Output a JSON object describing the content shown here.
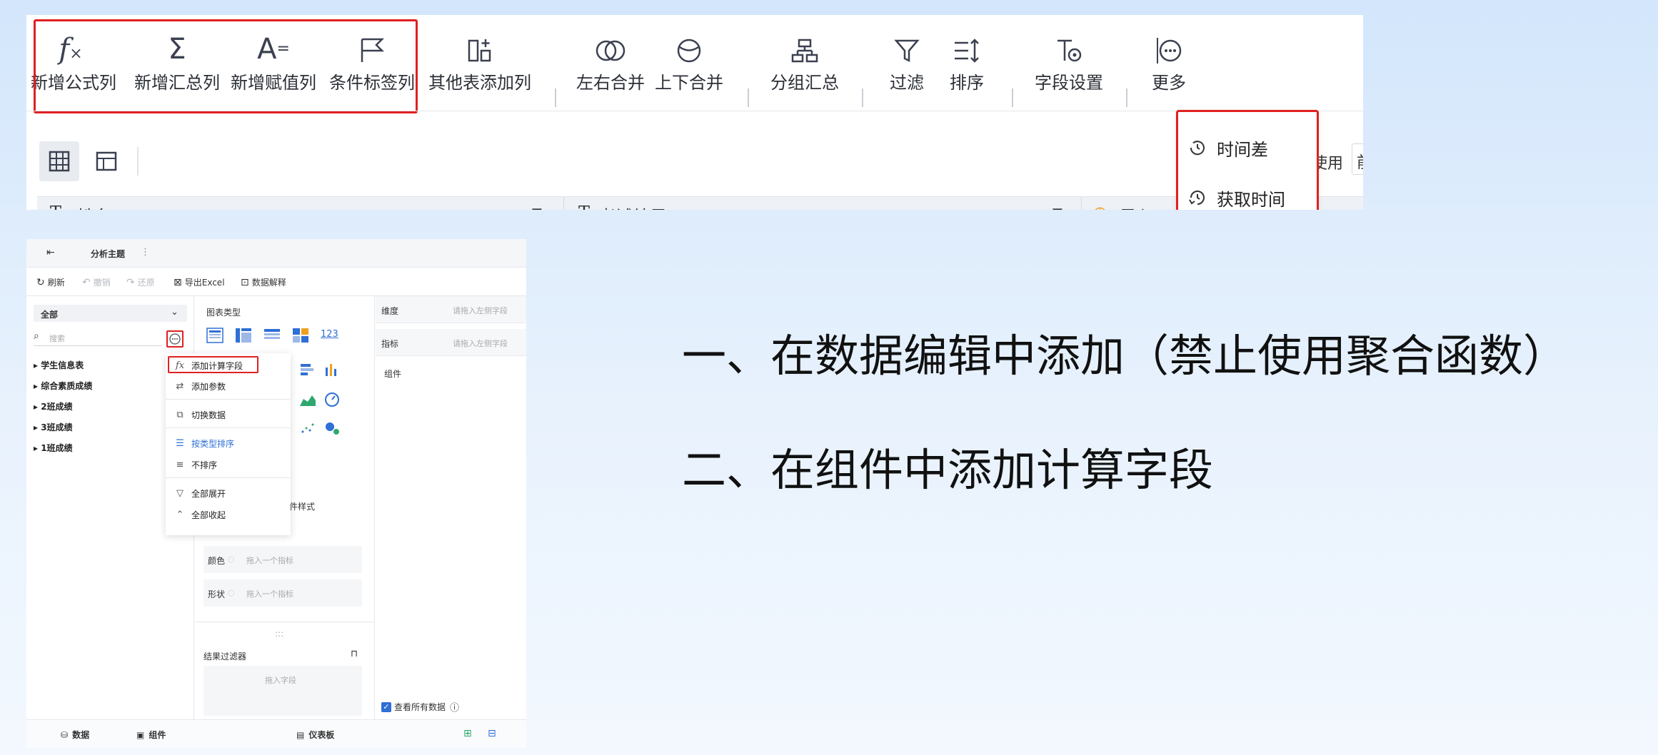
{
  "toolbar": {
    "items": [
      {
        "label": "新增公式列",
        "icon": "fx-icon"
      },
      {
        "label": "新增汇总列",
        "icon": "sigma-icon"
      },
      {
        "label": "新增赋值列",
        "icon": "assign-icon"
      },
      {
        "label": "条件标签列",
        "icon": "flag-icon"
      },
      {
        "label": "其他表添加列",
        "icon": "add-column-icon"
      },
      {
        "label": "左右合并",
        "icon": "merge-horizontal-icon"
      },
      {
        "label": "上下合并",
        "icon": "merge-vertical-icon"
      },
      {
        "label": "分组汇总",
        "icon": "group-summary-icon"
      },
      {
        "label": "过滤",
        "icon": "filter-icon"
      },
      {
        "label": "排序",
        "icon": "sort-icon"
      },
      {
        "label": "字段设置",
        "icon": "field-settings-icon"
      },
      {
        "label": "更多",
        "icon": "more-icon"
      }
    ]
  },
  "more_menu": {
    "items": [
      {
        "label": "时间差",
        "icon": "clock-icon"
      },
      {
        "label": "获取时间",
        "icon": "clock-refresh-icon"
      }
    ]
  },
  "view_row": {
    "use_label": "使用",
    "use_value": "前"
  },
  "table_header": {
    "columns": [
      {
        "label": "姓名",
        "type_icon": "text-type-icon"
      },
      {
        "label": "考试结果",
        "type_icon": "text-type-icon"
      },
      {
        "label": "录入",
        "type_icon": "time-type-icon"
      }
    ]
  },
  "editor": {
    "title": "分析主题",
    "actions": {
      "refresh": "刷新",
      "undo": "撤销",
      "redo": "还原",
      "export": "导出Excel",
      "explain": "数据解释"
    },
    "left": {
      "scope": "全部",
      "search_placeholder": "搜索",
      "tree": [
        "学生信息表",
        "综合素质成绩",
        "2班成绩",
        "3班成绩",
        "1班成绩"
      ]
    },
    "context_menu": {
      "add_calc_field": "添加计算字段",
      "add_param": "添加参数",
      "switch_data": "切换数据",
      "sort_by_type": "按类型排序",
      "no_sort": "不排序",
      "expand_all": "全部展开",
      "collapse_all": "全部收起"
    },
    "middle": {
      "chart_type_label": "图表类型",
      "number_chart_label": "123",
      "tab_style": "组件样式",
      "color_label": "颜色",
      "color_placeholder": "拖入一个指标",
      "shape_label": "形状",
      "shape_placeholder": "拖入一个指标",
      "result_filter": "结果过滤器",
      "drag_field": "拖入字段"
    },
    "right": {
      "dimension_label": "维度",
      "dimension_placeholder": "请拖入左侧字段",
      "metric_label": "指标",
      "metric_placeholder": "请拖入左侧字段",
      "component_label": "组件",
      "view_all_data": "查看所有数据"
    },
    "bottom_tabs": {
      "data": "数据",
      "component": "组件",
      "dashboard": "仪表板"
    }
  },
  "headlines": {
    "line1": "一、在数据编辑中添加（禁止使用聚合函数）",
    "line2": "二、在组件中添加计算字段"
  },
  "colors": {
    "highlight_red": "#e02020",
    "accent_blue": "#2f6fd6"
  }
}
